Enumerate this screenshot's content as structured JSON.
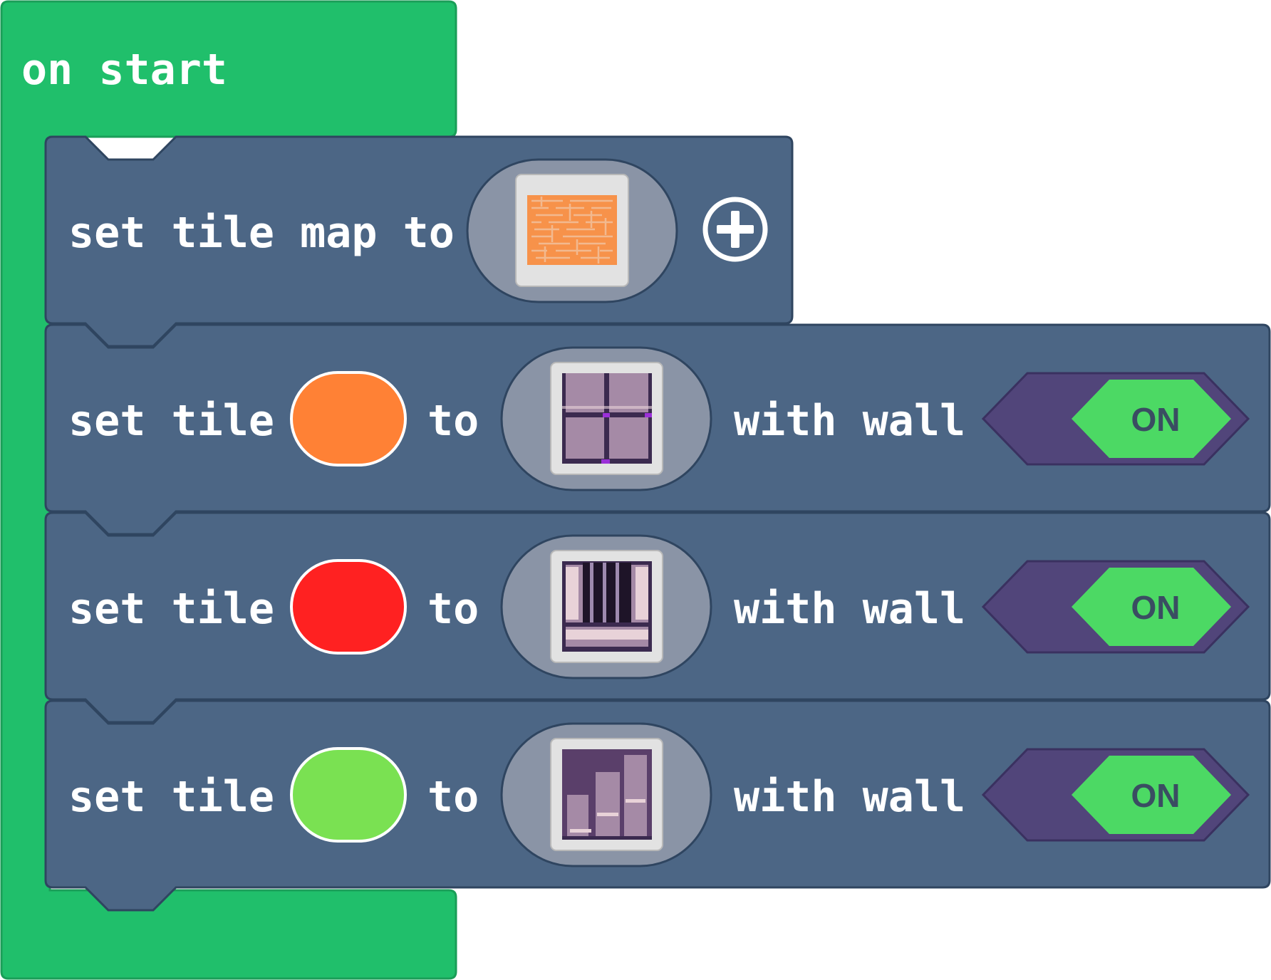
{
  "hat_block": {
    "label": "on start",
    "color": "#20BF6B"
  },
  "tilemap_block": {
    "label_prefix": "set tile map to",
    "image_icon": "maze-tilemap-thumbnail",
    "add_icon": "plus-circle-icon"
  },
  "set_tile_blocks": [
    {
      "label": "set tile",
      "color_value": "#FF8135",
      "to_label": "to",
      "tile_icon": "brick-window-tile",
      "wall_label": "with wall",
      "toggle_text": "ON"
    },
    {
      "label": "set tile",
      "color_value": "#FF2121",
      "to_label": "to",
      "tile_icon": "door-bars-tile",
      "wall_label": "with wall",
      "toggle_text": "ON"
    },
    {
      "label": "set tile",
      "color_value": "#7AE152",
      "to_label": "to",
      "tile_icon": "stair-steps-tile",
      "wall_label": "with wall",
      "toggle_text": "ON"
    }
  ],
  "colors": {
    "block": "#4C6685",
    "block_border": "#2F4560",
    "slot": "#8A94A6",
    "toggle_bg": "#51457A",
    "toggle_on": "#4CD964",
    "toggle_on_text": "#3A4D62"
  }
}
